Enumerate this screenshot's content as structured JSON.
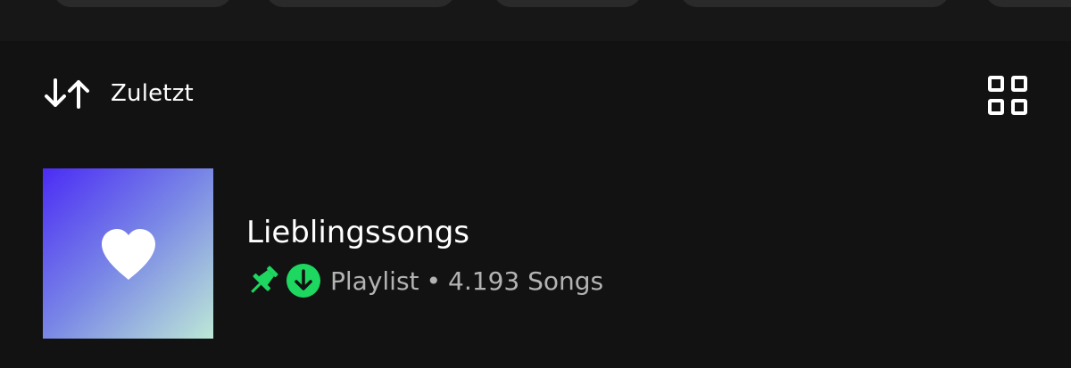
{
  "sort": {
    "label": "Zuletzt",
    "icon": "sort-arrows-icon"
  },
  "view_toggle": {
    "icon": "grid-view-icon"
  },
  "library": {
    "items": [
      {
        "title": "Lieblingssongs",
        "type": "Playlist",
        "separator": "•",
        "count": "4.193 Songs",
        "cover_icon": "heart-icon",
        "pinned_icon": "pin-icon",
        "downloaded_icon": "download-icon"
      }
    ]
  },
  "colors": {
    "background": "#121212",
    "accent_green": "#1ed760",
    "secondary_text": "#b3b3b3",
    "cover_gradient": [
      "#4b2cf5",
      "#7a88e6",
      "#bde8d6"
    ]
  }
}
